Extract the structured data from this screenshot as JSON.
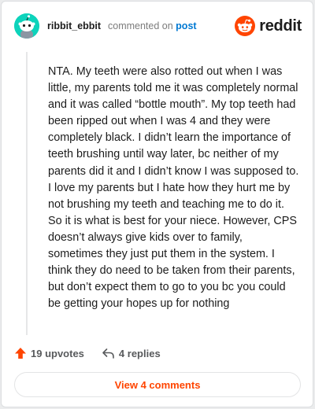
{
  "header": {
    "username": "ribbit_ebbit",
    "commented_text": "commented on",
    "post_link": "post",
    "brand": "reddit",
    "brand_color": "#ff4500",
    "avatar_color": "#0dd3bb"
  },
  "comment": {
    "body": "NTA. My teeth were also rotted out when I was little, my parents told me it was completely normal and it was called “bottle mouth”. My top teeth had been ripped out when I was 4 and they were completely black. I didn’t learn the importance of teeth brushing until way later, bc neither of my parents did it and I didn’t know I was supposed to. I love my parents but I hate how they hurt me by not brushing my teeth and teaching me to do it. So it is what is best for your niece. However, CPS doesn’t always give kids over to family, sometimes they just put them in the system. I think they do need to be taken from their parents, but don’t expect them to go to you bc you could be getting your hopes up for nothing"
  },
  "actions": {
    "upvotes": "19 upvotes",
    "replies": "4 replies",
    "upvote_icon": "upvote-arrow-icon",
    "reply_icon": "reply-arrow-icon"
  },
  "footer": {
    "view_comments": "View 4 comments"
  }
}
